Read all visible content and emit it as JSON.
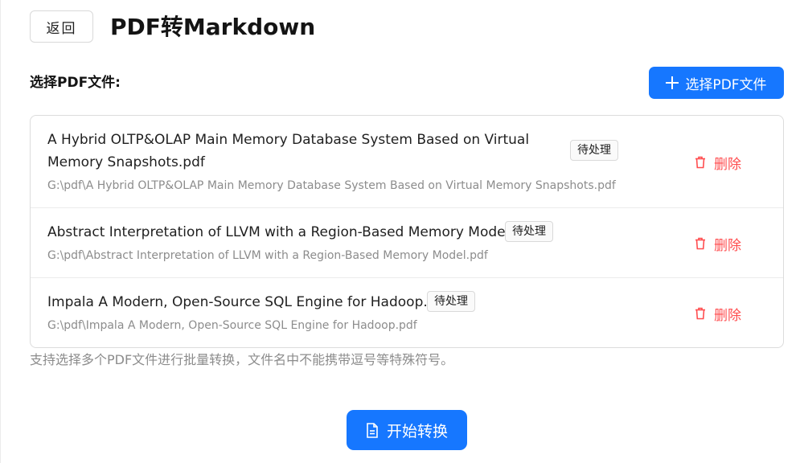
{
  "header": {
    "back_label": "返回",
    "title": "PDF转Markdown"
  },
  "upload": {
    "section_label": "选择PDF文件:",
    "select_button_label": "选择PDF文件"
  },
  "files": [
    {
      "name": "A Hybrid OLTP&OLAP Main Memory Database System Based on Virtual Memory Snapshots.pdf",
      "status": "待处理",
      "path": "G:\\pdf\\A Hybrid OLTP&OLAP Main Memory Database System Based on Virtual Memory Snapshots.pdf",
      "delete_label": "删除"
    },
    {
      "name": "Abstract Interpretation of LLVM with a Region-Based Memory Model.pdf",
      "status": "待处理",
      "path": "G:\\pdf\\Abstract Interpretation of LLVM with a Region-Based Memory Model.pdf",
      "delete_label": "删除"
    },
    {
      "name": "Impala A Modern, Open-Source SQL Engine for Hadoop.pdf",
      "status": "待处理",
      "path": "G:\\pdf\\Impala A Modern, Open-Source SQL Engine for Hadoop.pdf",
      "delete_label": "删除"
    }
  ],
  "hint": "支持选择多个PDF文件进行批量转换，文件名中不能携带逗号等特殊符号。",
  "actions": {
    "start_label": "开始转换"
  },
  "colors": {
    "primary": "#1677ff",
    "danger": "#ff4d4f",
    "muted_text": "#8c8c8c"
  },
  "icons": {
    "add": "plus-icon",
    "delete": "trash-icon",
    "start": "file-text-icon"
  }
}
